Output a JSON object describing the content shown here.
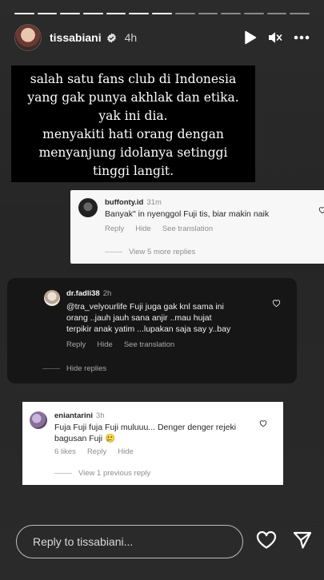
{
  "story": {
    "progress_total": 13,
    "progress_done": 7,
    "username": "tissabiani",
    "time_ago": "4h",
    "icons": [
      "play-icon",
      "mute-icon",
      "more-icon"
    ]
  },
  "caption": {
    "lines": [
      "salah satu fans club di Indonesia",
      "yang gak punya akhlak dan etika.",
      "yak ini dia.",
      "menyakiti hati orang dengan",
      "menyanjung idolanya setinggi",
      "tinggi langit."
    ]
  },
  "comment1": {
    "username": "buffonty.id",
    "time": "31m",
    "text": "Banyak\" in nyenggol Fuji tis, biar makin naik",
    "reply": "Reply",
    "hide": "Hide",
    "translation": "See translation",
    "view_more": "View 5 more replies"
  },
  "comment2": {
    "username": "dr.fadli38",
    "time": "2h",
    "text_lines": [
      "@tra_velyourlife Fuji juga gak knl sama ini",
      "orang ..jauh jauh sana anjir ..mau hujat",
      "terpikir anak yatim ...lupakan saja say y..bay"
    ],
    "reply": "Reply",
    "hide": "Hide",
    "translation": "See translation",
    "hide_replies": "Hide replies"
  },
  "comment3": {
    "username": "eniantarini",
    "time": "3h",
    "text_lines": [
      "Fuja Fuji fuja Fuji muluuu... Denger denger rejeki",
      "bagusan Fuji 🥲"
    ],
    "likes": "6 likes",
    "reply": "Reply",
    "hide": "Hide",
    "view_previous": "View 1 previous reply"
  },
  "footer": {
    "reply_placeholder": "Reply to tissabiani...",
    "icons": [
      "heart-icon",
      "send-icon"
    ]
  },
  "colors": {
    "story_bg": "#2a2a2a",
    "black_box": "#000000",
    "dark_card": "#161616",
    "muted_light": "#8e8e8e"
  }
}
